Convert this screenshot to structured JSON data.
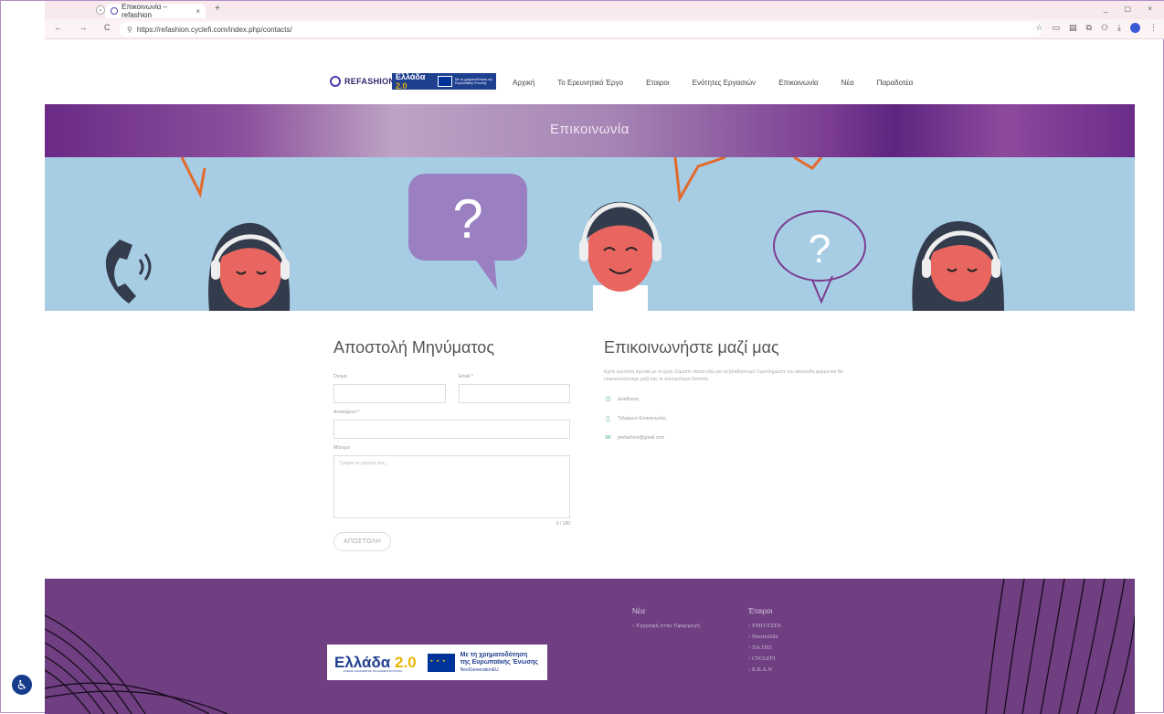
{
  "browser": {
    "tab_title": "Επικοινωνία – refashion",
    "tab_close": "×",
    "new_tab": "+",
    "url": "https://refashion.cyclefi.com/index.php/contacts/",
    "window_controls": "_ ▢ ×",
    "nav_glyphs": "← → C ⌂"
  },
  "site": {
    "logo_text": "REFASHION",
    "badge_title": "Ελλάδα",
    "badge_version": "2.0",
    "badge_eu_text": "Με τη χρηματοδότηση της Ευρωπαϊκής Ένωσης",
    "menu": [
      "Αρχική",
      "Το Ερευνητικό Έργο",
      "Εταιροι",
      "Ενότητες Εργασιών",
      "Επικοινωνία",
      "Νέα",
      "Παραδοτέα"
    ]
  },
  "hero": {
    "title": "Επικοινωνία",
    "question_mark": "?"
  },
  "form": {
    "heading": "Αποστολή Μηνύματος",
    "name_label": "Όνομα",
    "email_label": "Email *",
    "subject_label": "Αντικείμενο *",
    "message_label": "Μήνυμα",
    "message_placeholder": "Γράψτε το μήνυμά σας...",
    "counter": "0 / 180",
    "send_label": "ΑΠΟΣΤΟΛΗ"
  },
  "contact": {
    "heading": "Επικοινωνήστε μαζί μας",
    "intro": "Εχετε ερώτηση σχετικά με το έργο; Είμαστε πάντα εδώ για να βοηθήσουμε! Συμπληρώστε την ακόλουθη φόρμα και θα επικοινωνήσουμε μαζί σας το συντομότερο δυνατόν.",
    "address": "Διεύθυνση",
    "phone": "Τηλέφωνο Επικοινωνίας",
    "email": "prefashion@gmail.com"
  },
  "footer": {
    "badge_title": "Ελλάδα",
    "badge_version": "2.0",
    "badge_sub": "ΣΧΕΔΙΟ ΑΝΑΚΑΜΨΗΣ ΚΑΙ ΑΝΘΕΚΤΙΚΟΤΗΤΑΣ",
    "badge_eu_line1": "Με τη χρηματοδότηση",
    "badge_eu_line2": "της Ευρωπαϊκής Ένωσης",
    "badge_eu_line3": "NextGenerationEU",
    "news_heading": "Νέα",
    "news_items": [
      "Εγγραφή στην Εφαρμογή"
    ],
    "partners_heading": "Έταιροι",
    "partners": [
      "ΕΜΠ-ΕΣΕΕ",
      "Neotextile",
      "ΠΑ.ΠΕΙ",
      "CYCLEFI",
      "Ε.Κ.Α.Ν"
    ]
  },
  "accessibility_label": "♿"
}
